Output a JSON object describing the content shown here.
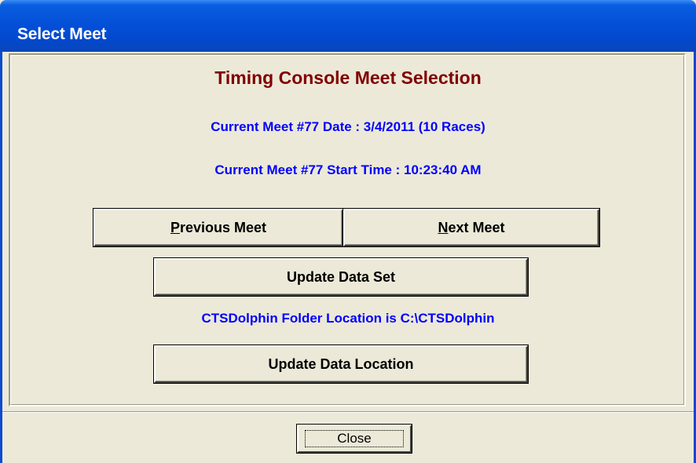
{
  "window": {
    "title": "Select Meet"
  },
  "main": {
    "heading": "Timing Console Meet Selection",
    "meet_date_line": "Current Meet #77 Date : 3/4/2011 (10 Races)",
    "meet_start_line": "Current Meet #77 Start Time : 10:23:40 AM",
    "previous_button": {
      "accel": "P",
      "rest": "revious Meet"
    },
    "next_button": {
      "accel": "N",
      "rest": "ext Meet"
    },
    "update_data_set_label": "Update Data Set",
    "folder_location_line": "CTSDolphin Folder Location is C:\\CTSDolphin",
    "update_data_location_label": "Update Data Location"
  },
  "footer": {
    "close_label": "Close"
  },
  "colors": {
    "heading": "#800000",
    "info_text": "#0000ff",
    "titlebar": "#0450d8",
    "face": "#ece9d8"
  }
}
